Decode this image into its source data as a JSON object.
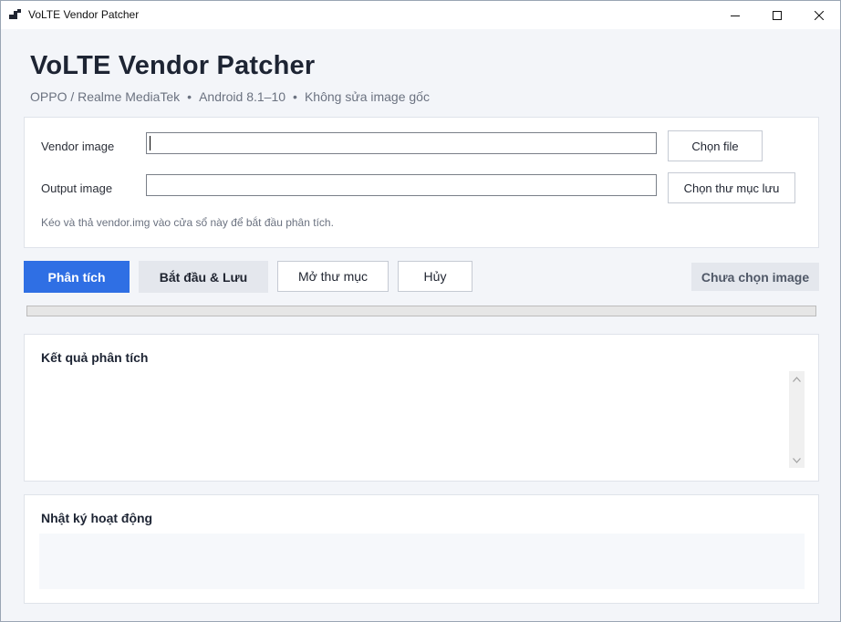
{
  "window": {
    "title": "VoLTE Vendor Patcher"
  },
  "header": {
    "title": "VoLTE Vendor Patcher",
    "subtitle": [
      "OPPO / Realme MediaTek",
      "Android 8.1–10",
      "Không sửa image gốc"
    ],
    "separator": "•"
  },
  "form": {
    "vendor_label": "Vendor image",
    "vendor_value": "",
    "vendor_button": "Chọn file",
    "output_label": "Output image",
    "output_value": "",
    "output_button": "Chọn thư mục lưu",
    "hint": "Kéo và thả vendor.img vào cửa sổ này để bắt đầu phân tích."
  },
  "actions": {
    "analyze": "Phân tích",
    "start_save": "Bắt đầu & Lưu",
    "open_folder": "Mở thư mục",
    "cancel": "Hủy",
    "status": "Chưa chọn image"
  },
  "progress": {
    "value": 0
  },
  "results": {
    "title": "Kết quả phân tích",
    "content": ""
  },
  "log": {
    "title": "Nhật ký hoạt động",
    "content": ""
  },
  "icons": {
    "app": "app-icon",
    "minimize": "minimize-icon",
    "maximize": "maximize-icon",
    "close": "close-icon",
    "scroll_up": "scroll-up-icon",
    "scroll_down": "scroll-down-icon"
  },
  "colors": {
    "accent": "#2f6fe4",
    "background": "#f3f5f9",
    "card": "#ffffff"
  }
}
